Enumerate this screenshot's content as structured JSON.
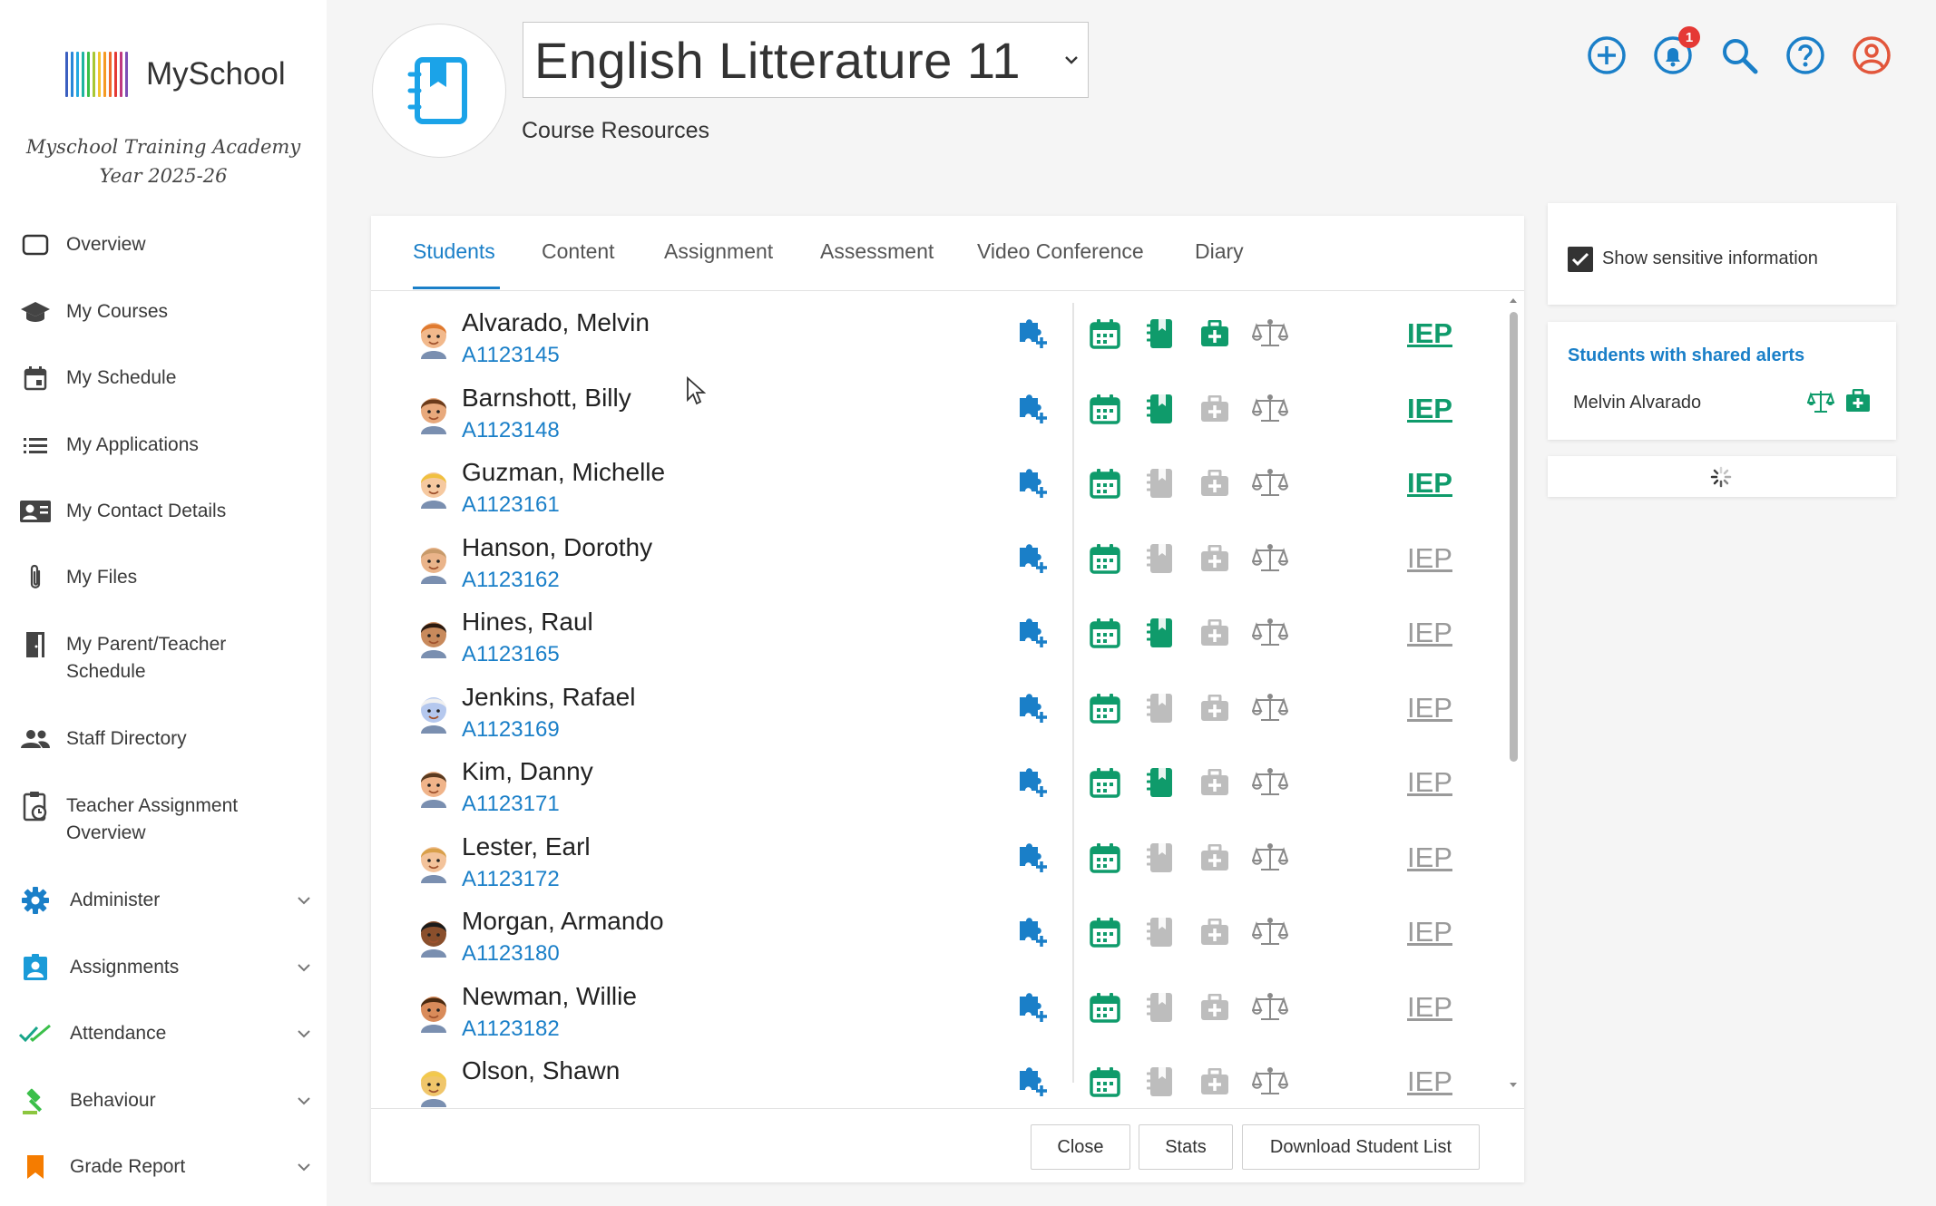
{
  "app": {
    "name": "MySchool",
    "school_name": "Myschool Training Academy",
    "school_year": "Year 2025-26",
    "logo_colors": [
      "#3b5fc0",
      "#2a87d8",
      "#23a9e0",
      "#1fb5a0",
      "#3bbf4a",
      "#a8c735",
      "#f4c430",
      "#f59a23",
      "#ee6b2c",
      "#e53935",
      "#c0397f",
      "#7d4fb5"
    ]
  },
  "sidebar": {
    "items": [
      {
        "label": "Overview",
        "icon": "tablet-icon"
      },
      {
        "label": "My Courses",
        "icon": "graduation-cap-icon"
      },
      {
        "label": "My Schedule",
        "icon": "calendar-icon"
      },
      {
        "label": "My Applications",
        "icon": "list-icon"
      },
      {
        "label": "My Contact Details",
        "icon": "contact-card-icon"
      },
      {
        "label": "My Files",
        "icon": "paperclip-icon"
      },
      {
        "label": "My Parent/Teacher",
        "label2": "Schedule",
        "icon": "door-icon"
      },
      {
        "label": "Staff Directory",
        "icon": "people-icon"
      },
      {
        "label": "Teacher Assignment",
        "label2": "Overview",
        "icon": "clipboard-clock-icon"
      }
    ],
    "groups": [
      {
        "label": "Administer",
        "icon": "gear-icon",
        "color": "#1a7fc8"
      },
      {
        "label": "Assignments",
        "icon": "badge-icon",
        "color": "#1a9bd8"
      },
      {
        "label": "Attendance",
        "icon": "double-check-icon",
        "color": "#18a589"
      },
      {
        "label": "Behaviour",
        "icon": "gavel-icon",
        "color": "#3bbf4a"
      },
      {
        "label": "Grade Report",
        "icon": "bookmark-icon",
        "color": "#f57c00"
      }
    ]
  },
  "header": {
    "course_title": "English Litterature 11",
    "page_subtitle": "Course Resources",
    "notification_count": "1",
    "accent": "#1a7fc8",
    "profile_color": "#e2563b"
  },
  "tabs": [
    "Students",
    "Content",
    "Assignment",
    "Assessment",
    "Video Conference",
    "Diary"
  ],
  "active_tab": "Students",
  "students": [
    {
      "name": "Alvarado, Melvin",
      "id": "A1123145",
      "book": true,
      "medical": true,
      "iep": true
    },
    {
      "name": "Barnshott, Billy",
      "id": "A1123148",
      "book": true,
      "medical": false,
      "iep": true
    },
    {
      "name": "Guzman, Michelle",
      "id": "A1123161",
      "book": false,
      "medical": false,
      "iep": true
    },
    {
      "name": "Hanson, Dorothy",
      "id": "A1123162",
      "book": false,
      "medical": false,
      "iep": false
    },
    {
      "name": "Hines, Raul",
      "id": "A1123165",
      "book": true,
      "medical": false,
      "iep": false
    },
    {
      "name": "Jenkins, Rafael",
      "id": "A1123169",
      "book": false,
      "medical": false,
      "iep": false
    },
    {
      "name": "Kim, Danny",
      "id": "A1123171",
      "book": true,
      "medical": false,
      "iep": false
    },
    {
      "name": "Lester, Earl",
      "id": "A1123172",
      "book": false,
      "medical": false,
      "iep": false
    },
    {
      "name": "Morgan, Armando",
      "id": "A1123180",
      "book": false,
      "medical": false,
      "iep": false
    },
    {
      "name": "Newman, Willie",
      "id": "A1123182",
      "book": false,
      "medical": false,
      "iep": false
    },
    {
      "name": "Olson, Shawn",
      "id": "",
      "book": false,
      "medical": false,
      "iep": false
    }
  ],
  "iep_label": "IEP",
  "footer": {
    "close": "Close",
    "stats": "Stats",
    "download": "Download Student List"
  },
  "right_panel": {
    "show_sensitive_label": "Show sensitive information",
    "show_sensitive_checked": true,
    "alerts_title": "Students with shared alerts",
    "alert_student": "Melvin Alvarado"
  },
  "colors": {
    "green": "#0f9b6b",
    "blue": "#1a7fc8",
    "gray": "#bdbdbd"
  }
}
